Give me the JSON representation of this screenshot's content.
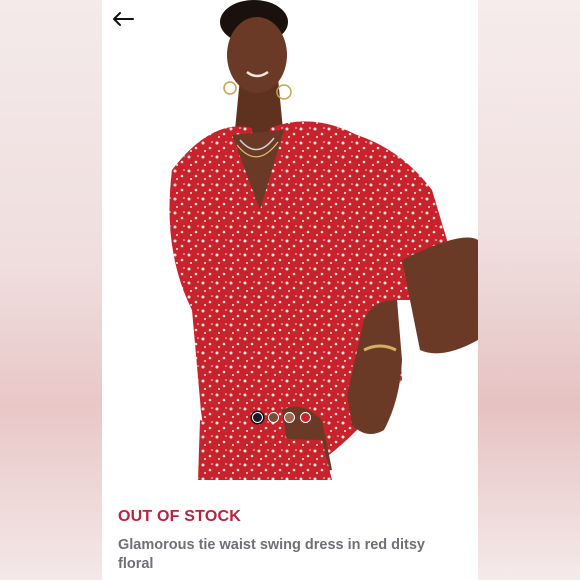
{
  "listing": {
    "status_label": "OUT OF STOCK",
    "product_title": "Glamorous tie waist swing dress in red ditsy floral"
  },
  "colors": {
    "status": "#b8243f",
    "title": "#6f6f7a",
    "dress": "#c8232c",
    "skin": "#6b3a26"
  },
  "icons": {
    "back": "arrow-left-icon"
  },
  "image_nav": {
    "swatch_count": 4,
    "active_index": 0
  }
}
